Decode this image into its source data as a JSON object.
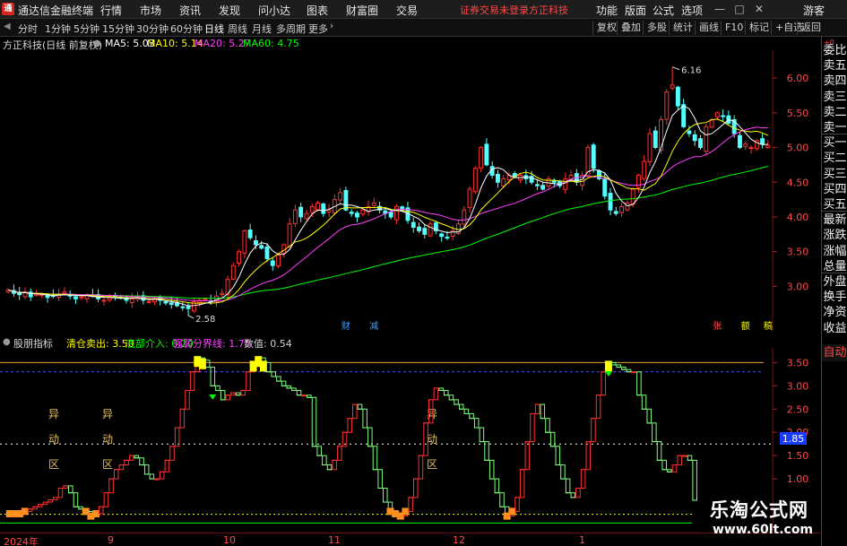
{
  "app": {
    "logo_letter": "通",
    "title": "通达信金融终端",
    "menu": [
      "行情",
      "市场",
      "资讯",
      "发现",
      "问小达",
      "图表",
      "财富圈",
      "交易"
    ],
    "notice_login": "证券交易未登录",
    "notice_stock": "方正科技",
    "right_menu": [
      "功能",
      "版面",
      "公式",
      "选项"
    ],
    "window_buttons": [
      "minimize-icon",
      "restore-icon",
      "close-icon"
    ],
    "guest": "游客"
  },
  "toolbar": {
    "periods": [
      "分时",
      "1分钟",
      "5分钟",
      "15分钟",
      "30分钟",
      "60分钟",
      "日线",
      "周线",
      "月线",
      "多周期",
      "更多"
    ],
    "active_period": "日线",
    "tools": [
      "复权",
      "叠加",
      "多股",
      "统计",
      "画线",
      "F10",
      "标记",
      "+自选",
      "返回"
    ]
  },
  "main_info": {
    "stock": "方正科技(日线 前复权)",
    "ma5": "MA5: 5.03",
    "ma10": "MA10: 5.14",
    "ma20": "MA20: 5.27",
    "ma60": "MA60: 4.75",
    "colors": {
      "ma5": "#ffffff",
      "ma10": "#ffff00",
      "ma20": "#ff40ff",
      "ma60": "#00ff00"
    }
  },
  "main_axis": {
    "labels": [
      "6.00",
      "5.50",
      "5.00",
      "4.50",
      "4.00",
      "3.50",
      "3.00"
    ],
    "values": [
      6.0,
      5.5,
      5.0,
      4.5,
      4.0,
      3.5,
      3.0
    ]
  },
  "main_annotations": {
    "high_label": "6.16",
    "low_label": "2.58",
    "event_markers": [
      {
        "text": "财",
        "color": "#3aa0ff"
      },
      {
        "text": "减",
        "color": "#3aa0ff"
      },
      {
        "text": "张",
        "color": "#ff4a4a"
      },
      {
        "text": "额",
        "color": "#ffff00"
      },
      {
        "text": "稿",
        "color": "#ffff00"
      }
    ]
  },
  "ind_info": {
    "name": "股朋指标",
    "sell": "清仓卖出: 3.50",
    "bottom": "底部介入: 0.20",
    "line": "强弱分界线: 1.75",
    "value": "数值: 0.54",
    "colors": {
      "sell": "#ffff00",
      "bottom": "#00ff00",
      "line": "#ff40ff",
      "value": "#cfcfcf"
    }
  },
  "ind_axis": {
    "labels": [
      "3.50",
      "3.00",
      "2.50",
      "2.00",
      "1.85",
      "1.50",
      "1.00"
    ],
    "values": [
      3.5,
      3.0,
      2.5,
      2.0,
      1.85,
      1.5,
      1.0
    ]
  },
  "ind_zones": {
    "text": [
      "异",
      "动",
      "区"
    ],
    "color": "#e8c060"
  },
  "sidebar": {
    "top": "+0",
    "items": [
      "委比",
      "卖五",
      "卖四",
      "卖三",
      "卖二",
      "卖一",
      "买一",
      "买二",
      "买三",
      "买四",
      "买五",
      "最新",
      "涨跌",
      "涨幅",
      "总量",
      "外盘",
      "换手",
      "净资",
      "收益"
    ],
    "auto": "自动"
  },
  "dates": [
    "2024年",
    "9",
    "10",
    "11",
    "12",
    "1"
  ],
  "watermark": {
    "line1": "乐淘公式网",
    "line2": "www.60lt.com"
  },
  "chart_data": [
    {
      "type": "candlestick",
      "title": "方正科技(日线 前复权)",
      "ylim": [
        2.45,
        6.35
      ],
      "y_ticks": [
        3.0,
        3.5,
        4.0,
        4.5,
        5.0,
        5.5,
        6.0
      ],
      "high": 6.16,
      "low": 2.58,
      "series": [
        {
          "name": "MA5",
          "last": 5.03
        },
        {
          "name": "MA10",
          "last": 5.14
        },
        {
          "name": "MA20",
          "last": 5.27
        },
        {
          "name": "MA60",
          "last": 4.75
        }
      ],
      "close": [
        2.95,
        2.9,
        2.88,
        2.92,
        2.85,
        2.9,
        2.88,
        2.84,
        2.86,
        2.89,
        2.92,
        2.86,
        2.82,
        2.85,
        2.88,
        2.86,
        2.82,
        2.8,
        2.84,
        2.86,
        2.83,
        2.8,
        2.82,
        2.85,
        2.8,
        2.78,
        2.82,
        2.8,
        2.76,
        2.74,
        2.72,
        2.7,
        2.68,
        2.78,
        2.8,
        2.82,
        2.78,
        2.86,
        2.9,
        3.1,
        3.3,
        3.5,
        3.8,
        3.7,
        3.6,
        3.55,
        3.4,
        3.3,
        3.45,
        3.6,
        3.9,
        4.1,
        4.0,
        4.05,
        4.15,
        4.2,
        4.05,
        4.1,
        4.25,
        4.35,
        4.1,
        4.05,
        4.0,
        4.1,
        4.15,
        4.2,
        4.1,
        4.05,
        4.0,
        4.15,
        4.1,
        3.95,
        3.85,
        3.8,
        3.75,
        3.9,
        3.8,
        3.72,
        3.7,
        3.8,
        3.9,
        4.1,
        4.4,
        4.7,
        5.0,
        4.75,
        4.6,
        4.5,
        4.55,
        4.6,
        4.58,
        4.6,
        4.55,
        4.5,
        4.45,
        4.4,
        4.55,
        4.5,
        4.45,
        4.55,
        4.6,
        4.5,
        4.6,
        5.0,
        4.7,
        4.55,
        4.3,
        4.1,
        4.05,
        4.15,
        4.2,
        4.4,
        4.6,
        4.8,
        5.2,
        5.0,
        5.4,
        5.8,
        5.9,
        5.6,
        5.3,
        5.2,
        5.1,
        5.0,
        5.3,
        5.4,
        5.5,
        5.45,
        5.35,
        5.2,
        5.0,
        5.05,
        5.0,
        5.1,
        5.05,
        5.03
      ]
    },
    {
      "type": "line",
      "title": "股朋指标",
      "ylim": [
        0.0,
        3.7
      ],
      "y_ticks": [
        1.0,
        1.5,
        1.85,
        2.0,
        2.5,
        3.0,
        3.5
      ],
      "levels": {
        "sell": 3.5,
        "bottom": 0.2,
        "split": 1.75
      },
      "last": 0.54,
      "values": [
        0.25,
        0.25,
        0.25,
        0.3,
        0.35,
        0.4,
        0.45,
        0.5,
        0.55,
        0.6,
        0.8,
        0.85,
        0.7,
        0.4,
        0.35,
        0.3,
        0.2,
        0.25,
        0.4,
        0.7,
        1.0,
        1.2,
        1.3,
        1.4,
        1.5,
        1.45,
        1.3,
        1.1,
        1.0,
        1.0,
        1.15,
        1.4,
        1.7,
        2.1,
        2.5,
        2.9,
        3.3,
        3.6,
        3.55,
        3.4,
        3.0,
        2.9,
        2.7,
        2.8,
        2.85,
        2.8,
        2.9,
        3.3,
        3.5,
        3.6,
        3.5,
        3.3,
        3.2,
        3.1,
        3.0,
        2.95,
        2.9,
        2.8,
        2.8,
        2.75,
        1.7,
        1.5,
        1.3,
        1.2,
        1.4,
        1.7,
        2.0,
        2.3,
        2.6,
        2.5,
        2.1,
        1.7,
        1.2,
        0.8,
        0.5,
        0.3,
        0.25,
        0.2,
        0.3,
        0.6,
        1.0,
        1.5,
        2.2,
        2.7,
        2.95,
        2.9,
        2.8,
        2.7,
        2.6,
        2.5,
        2.4,
        2.3,
        2.1,
        1.8,
        1.4,
        1.0,
        0.7,
        0.4,
        0.2,
        0.3,
        0.6,
        1.2,
        1.8,
        2.4,
        2.6,
        2.3,
        2.0,
        1.7,
        1.3,
        1.0,
        0.7,
        0.6,
        0.8,
        1.2,
        1.8,
        2.3,
        2.8,
        3.3,
        3.5,
        3.45,
        3.4,
        3.35,
        3.3,
        3.3,
        2.8,
        2.5,
        2.2,
        1.8,
        1.4,
        1.2,
        1.15,
        1.3,
        1.5,
        1.5,
        1.4,
        0.54
      ]
    }
  ]
}
